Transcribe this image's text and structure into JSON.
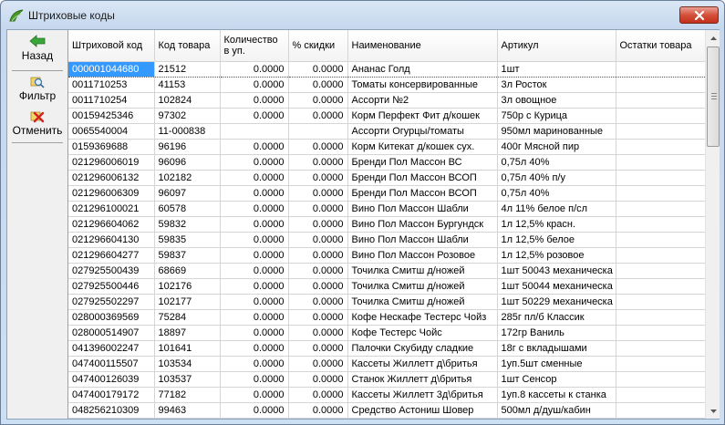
{
  "window": {
    "title": "Штриховые коды"
  },
  "toolbar": {
    "back_label": "Назад",
    "filter_label": "Фильтр",
    "cancel_label": "Отменить"
  },
  "columns": [
    "Штриховой код",
    "Код товара",
    "Количество в уп.",
    "% скидки",
    "Наименование",
    "Артикул",
    "Остатки товара"
  ],
  "rows": [
    {
      "barcode": "000001044680",
      "code": "21512",
      "qty": "0.0000",
      "disc": "0.0000",
      "name": "Ананас Голд",
      "art": "1шт",
      "stock": ""
    },
    {
      "barcode": "0011710253",
      "code": "41153",
      "qty": "0.0000",
      "disc": "0.0000",
      "name": "Томаты консервированные",
      "art": "3л Росток",
      "stock": ""
    },
    {
      "barcode": "0011710254",
      "code": "102824",
      "qty": "0.0000",
      "disc": "0.0000",
      "name": "Ассорти №2",
      "art": "3л овощное",
      "stock": ""
    },
    {
      "barcode": "00159425346",
      "code": "97302",
      "qty": "0.0000",
      "disc": "0.0000",
      "name": "Корм Перфект Фит д/кошек",
      "art": "750р с Курица",
      "stock": ""
    },
    {
      "barcode": "0065540004",
      "code": "11-000838",
      "qty": "",
      "disc": "",
      "name": "Ассорти Огурцы/томаты",
      "art": "950мл маринованные",
      "stock": ""
    },
    {
      "barcode": "0159369688",
      "code": "96196",
      "qty": "0.0000",
      "disc": "0.0000",
      "name": "Корм Китекат д/кошек сух.",
      "art": "400г Мясной пир",
      "stock": ""
    },
    {
      "barcode": "021296006019",
      "code": "96096",
      "qty": "0.0000",
      "disc": "0.0000",
      "name": "Бренди Пол Массон ВС",
      "art": "0,75л 40%",
      "stock": ""
    },
    {
      "barcode": "021296006132",
      "code": "102182",
      "qty": "0.0000",
      "disc": "0.0000",
      "name": "Бренди Пол Массон ВСОП",
      "art": "0,75л 40% п/у",
      "stock": ""
    },
    {
      "barcode": "021296006309",
      "code": "96097",
      "qty": "0.0000",
      "disc": "0.0000",
      "name": "Бренди Пол Массон ВСОП",
      "art": "0,75л 40%",
      "stock": ""
    },
    {
      "barcode": "021296100021",
      "code": "60578",
      "qty": "0.0000",
      "disc": "0.0000",
      "name": "Вино Пол Массон Шабли",
      "art": "4л 11% белое п/сл",
      "stock": ""
    },
    {
      "barcode": "021296604062",
      "code": "59832",
      "qty": "0.0000",
      "disc": "0.0000",
      "name": "Вино Пол Массон Бургундск",
      "art": "1л 12,5% красн.",
      "stock": ""
    },
    {
      "barcode": "021296604130",
      "code": "59835",
      "qty": "0.0000",
      "disc": "0.0000",
      "name": "Вино Пол Массон Шабли",
      "art": "1л 12,5% белое",
      "stock": ""
    },
    {
      "barcode": "021296604277",
      "code": "59837",
      "qty": "0.0000",
      "disc": "0.0000",
      "name": "Вино Пол Массон Розовое",
      "art": "1л 12,5% розовое",
      "stock": ""
    },
    {
      "barcode": "027925500439",
      "code": "68669",
      "qty": "0.0000",
      "disc": "0.0000",
      "name": "Точилка Смитш д/ножей",
      "art": "1шт 50043 механическа",
      "stock": ""
    },
    {
      "barcode": "027925500446",
      "code": "102176",
      "qty": "0.0000",
      "disc": "0.0000",
      "name": "Точилка Смитш д/ножей",
      "art": "1шт 50044 механическа",
      "stock": ""
    },
    {
      "barcode": "027925502297",
      "code": "102177",
      "qty": "0.0000",
      "disc": "0.0000",
      "name": "Точилка Смитш д/ножей",
      "art": "1шт 50229 механическа",
      "stock": ""
    },
    {
      "barcode": "028000369569",
      "code": "75284",
      "qty": "0.0000",
      "disc": "0.0000",
      "name": "Кофе Нескафе Тестерс Чойз",
      "art": "285г пл/б Классик",
      "stock": ""
    },
    {
      "barcode": "028000514907",
      "code": "18897",
      "qty": "0.0000",
      "disc": "0.0000",
      "name": "Кофе Тестерс Чойс",
      "art": "172гр  Ваниль",
      "stock": ""
    },
    {
      "barcode": "041396002247",
      "code": "101641",
      "qty": "0.0000",
      "disc": "0.0000",
      "name": "Палочки Скубиду сладкие",
      "art": "18г с вкладышами",
      "stock": ""
    },
    {
      "barcode": "047400115507",
      "code": "103534",
      "qty": "0.0000",
      "disc": "0.0000",
      "name": "Кассеты Жиллетт д\\бритья",
      "art": "1уп.5шт сменные",
      "stock": ""
    },
    {
      "barcode": "047400126039",
      "code": "103537",
      "qty": "0.0000",
      "disc": "0.0000",
      "name": "Станок Жиллетт д\\бритья",
      "art": "1шт Сенсор",
      "stock": ""
    },
    {
      "barcode": "047400179172",
      "code": "77182",
      "qty": "0.0000",
      "disc": "0.0000",
      "name": "Кассеты Жиллетт 3д\\бритья",
      "art": "1уп.8 кассеты к станка",
      "stock": ""
    },
    {
      "barcode": "048256210309",
      "code": "99463",
      "qty": "0.0000",
      "disc": "0.0000",
      "name": "Средство Астониш Шовер",
      "art": "500мл д/душ/кабин",
      "stock": ""
    }
  ]
}
